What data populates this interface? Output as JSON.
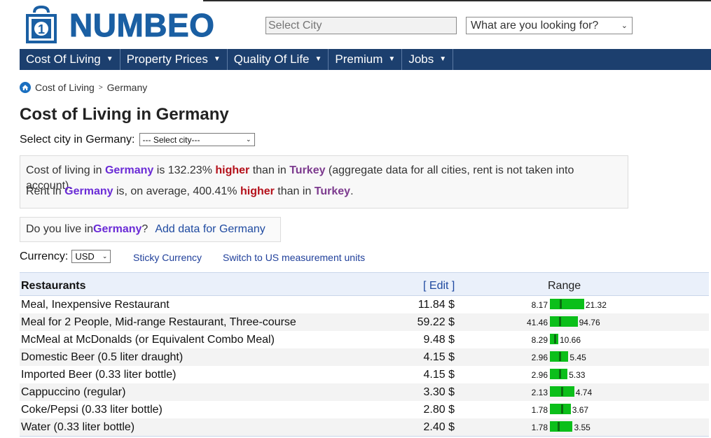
{
  "header": {
    "logo_text": "NUMBEO",
    "city_placeholder": "Select City",
    "search_select": "What are you looking for?"
  },
  "nav": [
    {
      "label": "Cost Of Living"
    },
    {
      "label": "Property Prices"
    },
    {
      "label": "Quality Of Life"
    },
    {
      "label": "Premium"
    },
    {
      "label": "Jobs"
    }
  ],
  "breadcrumb": {
    "root": "Cost of Living",
    "current": "Germany"
  },
  "page_title": "Cost of Living in Germany",
  "select_city": {
    "label": "Select city in Germany:",
    "value": "--- Select city---"
  },
  "compare": {
    "line1": {
      "pre": "Cost of living in ",
      "country": "Germany",
      "mid": " is 132.23% ",
      "higher": "higher",
      "than": " than in ",
      "other": "Turkey",
      "post": " (aggregate data for all cities, rent is not taken into account)."
    },
    "line2": {
      "pre": "Rent in ",
      "country": "Germany",
      "mid": " is, on average, 400.41% ",
      "higher": "higher",
      "than": " than in ",
      "other": "Turkey",
      "post": "."
    }
  },
  "live": {
    "pre": "Do you live in ",
    "country": "Germany",
    "post": "?",
    "link": "Add data for Germany"
  },
  "currency": {
    "label": "Currency:",
    "value": "USD",
    "sticky": "Sticky Currency",
    "switch": "Switch to US measurement units"
  },
  "table": {
    "title": "Restaurants",
    "edit": "[ Edit ]",
    "range": "Range",
    "rows": [
      {
        "name": "Meal, Inexpensive Restaurant",
        "price": "11.84 $",
        "min": "8.17",
        "max": "21.32",
        "min_v": 8.17,
        "max_v": 21.32,
        "val": 11.84
      },
      {
        "name": "Meal for 2 People, Mid-range Restaurant, Three-course",
        "price": "59.22 $",
        "min": "41.46",
        "max": "94.76",
        "min_v": 41.46,
        "max_v": 94.76,
        "val": 59.22
      },
      {
        "name": "McMeal at McDonalds (or Equivalent Combo Meal)",
        "price": "9.48 $",
        "min": "8.29",
        "max": "10.66",
        "min_v": 8.29,
        "max_v": 10.66,
        "val": 9.48
      },
      {
        "name": "Domestic Beer (0.5 liter draught)",
        "price": "4.15 $",
        "min": "2.96",
        "max": "5.45",
        "min_v": 2.96,
        "max_v": 5.45,
        "val": 4.15
      },
      {
        "name": "Imported Beer (0.33 liter bottle)",
        "price": "4.15 $",
        "min": "2.96",
        "max": "5.33",
        "min_v": 2.96,
        "max_v": 5.33,
        "val": 4.15
      },
      {
        "name": "Cappuccino (regular)",
        "price": "3.30 $",
        "min": "2.13",
        "max": "4.74",
        "min_v": 2.13,
        "max_v": 4.74,
        "val": 3.3
      },
      {
        "name": "Coke/Pepsi (0.33 liter bottle)",
        "price": "2.80 $",
        "min": "1.78",
        "max": "3.67",
        "min_v": 1.78,
        "max_v": 3.67,
        "val": 2.8
      },
      {
        "name": "Water (0.33 liter bottle)",
        "price": "2.40 $",
        "min": "1.78",
        "max": "3.55",
        "min_v": 1.78,
        "max_v": 3.55,
        "val": 2.4
      }
    ]
  },
  "colors": {
    "brand": "#1a5fa3",
    "nav": "#1c3f6e",
    "bar": "#0bbf1a",
    "higher": "#b4101a"
  }
}
